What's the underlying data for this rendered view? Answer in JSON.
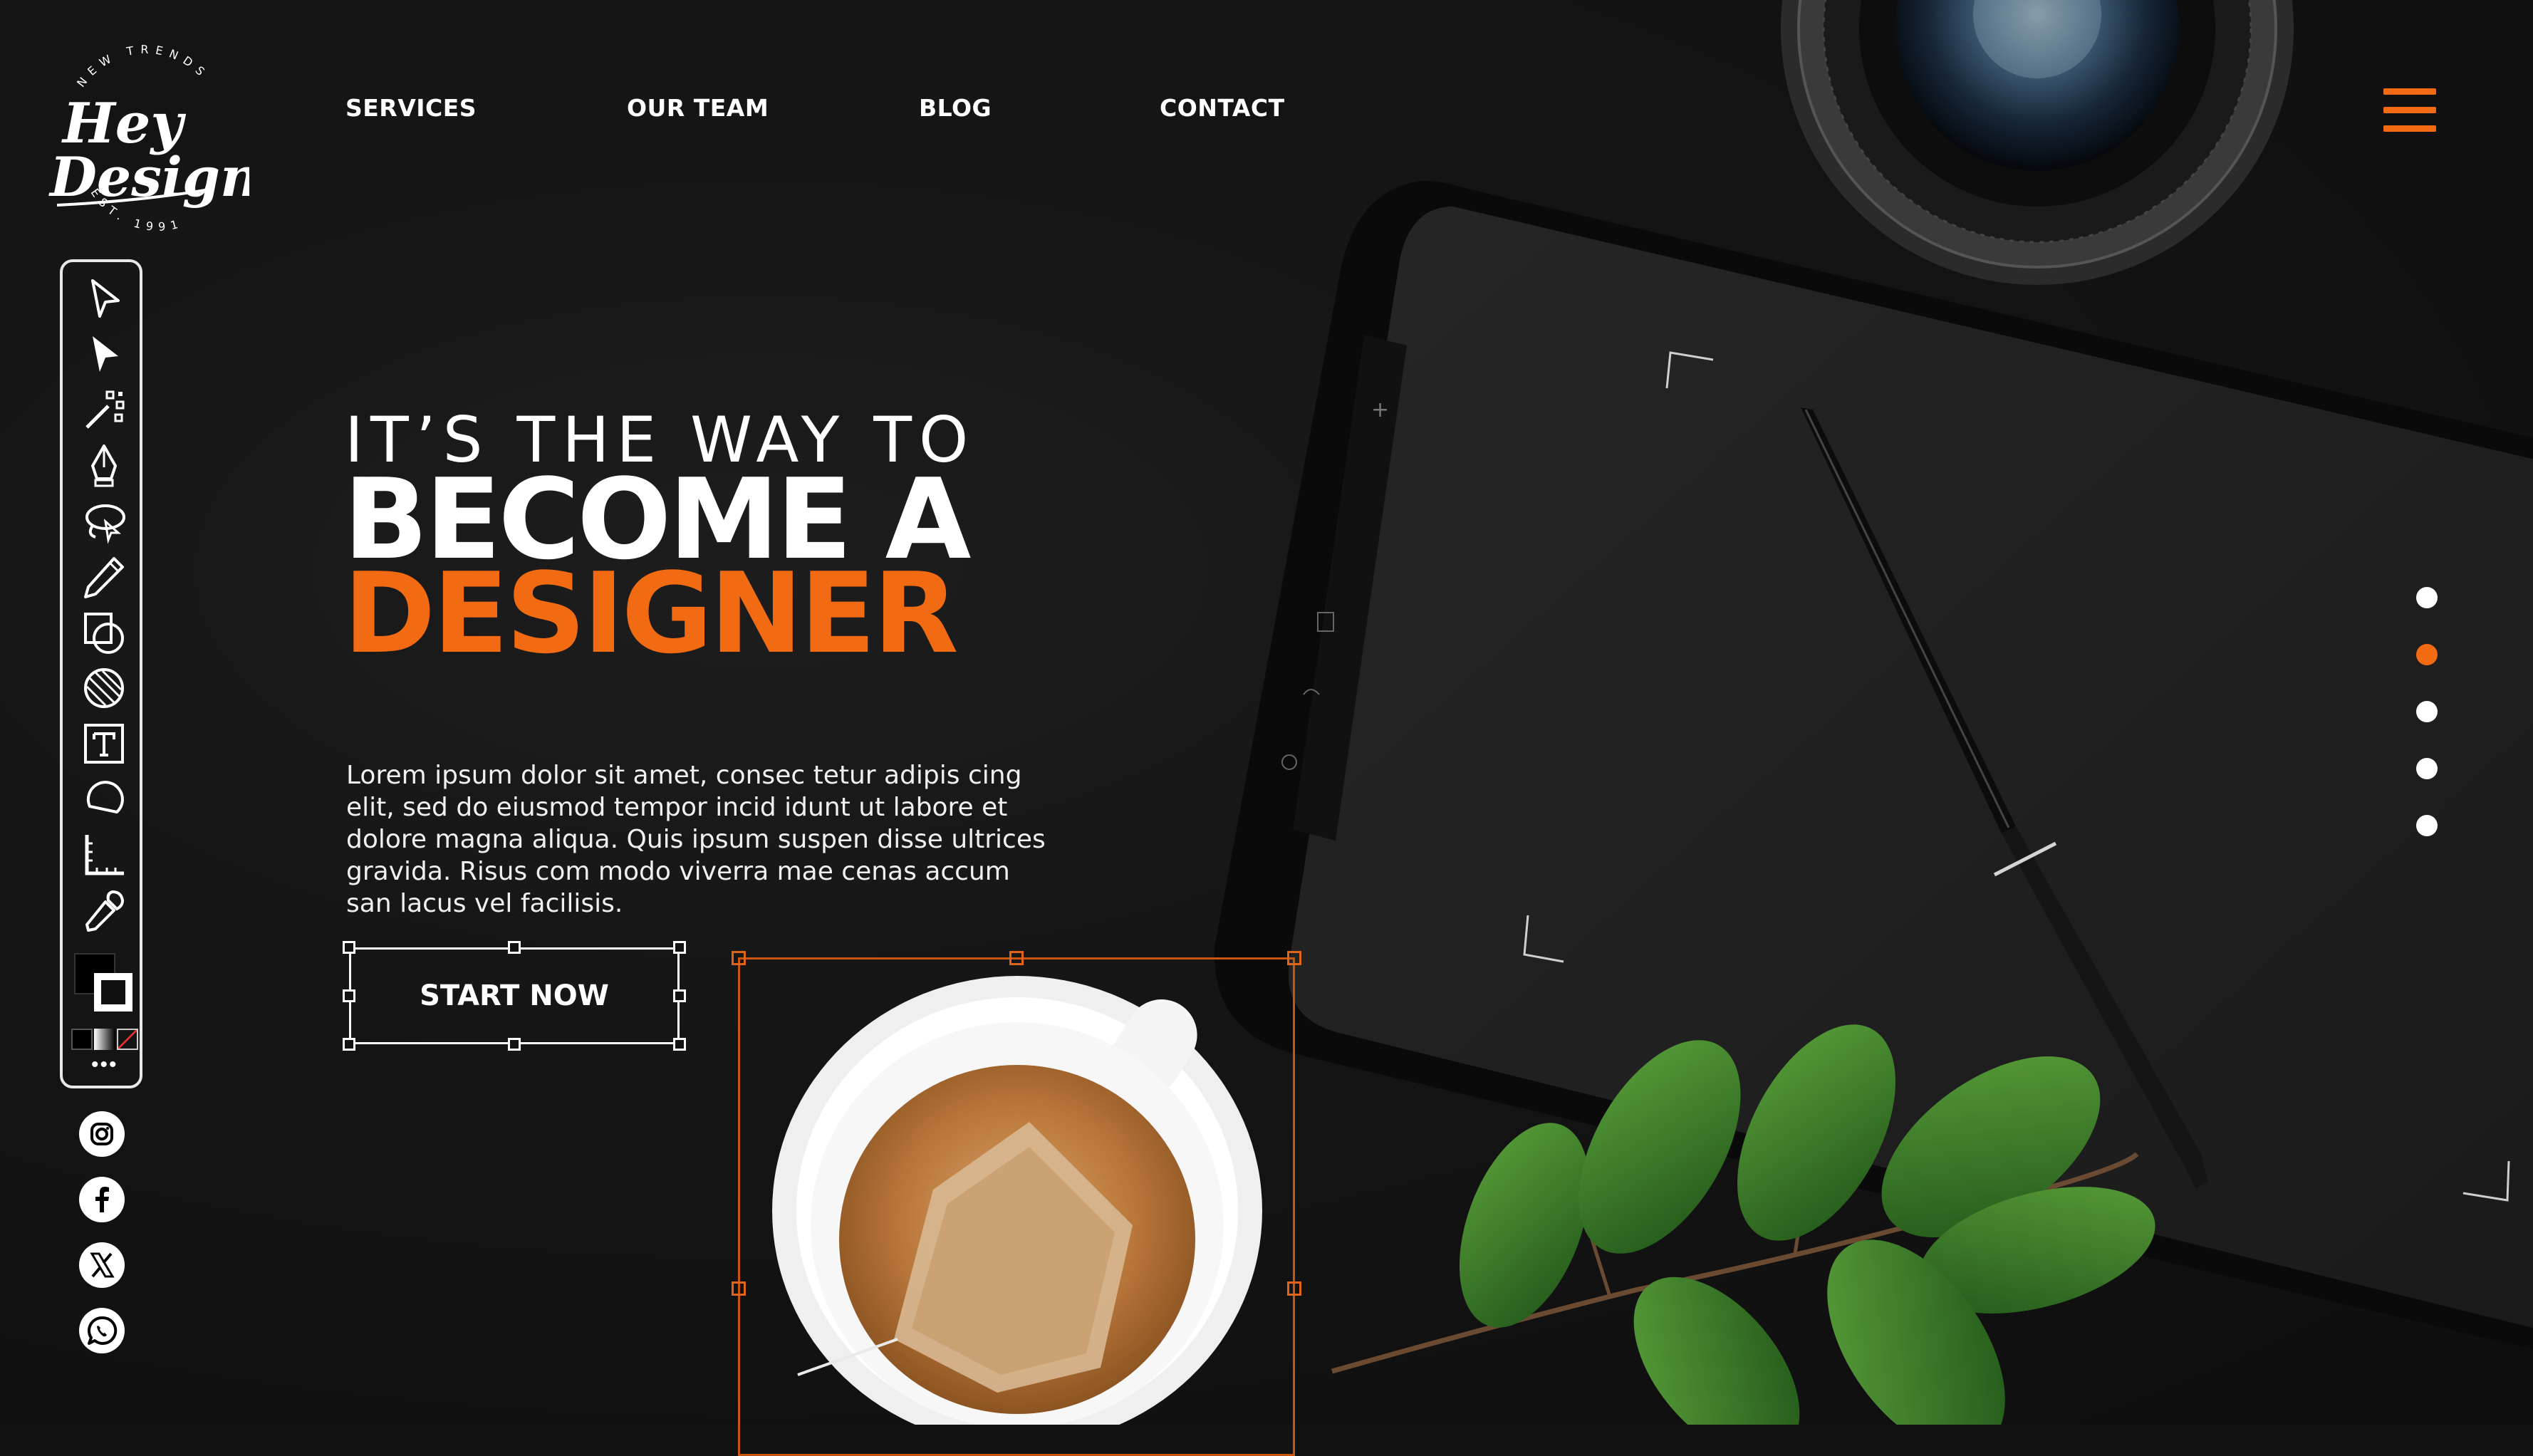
{
  "brand": {
    "name_line1": "Hey",
    "name_line2": "Design",
    "arc_top": "NEW TRENDS",
    "arc_bottom": "EST. 1991"
  },
  "nav": {
    "items": [
      {
        "label": "SERVICES"
      },
      {
        "label": "OUR TEAM"
      },
      {
        "label": "BLOG"
      },
      {
        "label": "CONTACT"
      }
    ]
  },
  "hero": {
    "eyebrow": "IT’S THE WAY TO",
    "headline_line1": "BECOME A",
    "headline_line2": "DESIGNER",
    "body": "Lorem ipsum dolor sit amet, consec tetur adipis cing elit, sed do eiusmod tempor incid idunt ut labore et dolore magna aliqua. Quis ipsum suspen disse ultrices gravida. Risus com modo viverra mae cenas accum san lacus vel facilisis.",
    "cta_label": "START NOW"
  },
  "toolbar": {
    "tools": [
      "selection-tool-icon",
      "direct-selection-tool-icon",
      "magic-wand-icon",
      "pen-tool-icon",
      "lasso-tool-icon",
      "pencil-tool-icon",
      "shape-tool-icon",
      "shape-builder-icon",
      "type-tool-icon",
      "rotate-tool-icon",
      "ruler-tool-icon",
      "eyedropper-icon"
    ],
    "more_label": "•••"
  },
  "social": [
    "instagram-icon",
    "facebook-icon",
    "x-icon",
    "whatsapp-icon"
  ],
  "pagination": {
    "count": 5,
    "active_index": 1
  },
  "colors": {
    "accent": "#f26a11",
    "background": "#121212",
    "text": "#ffffff"
  }
}
